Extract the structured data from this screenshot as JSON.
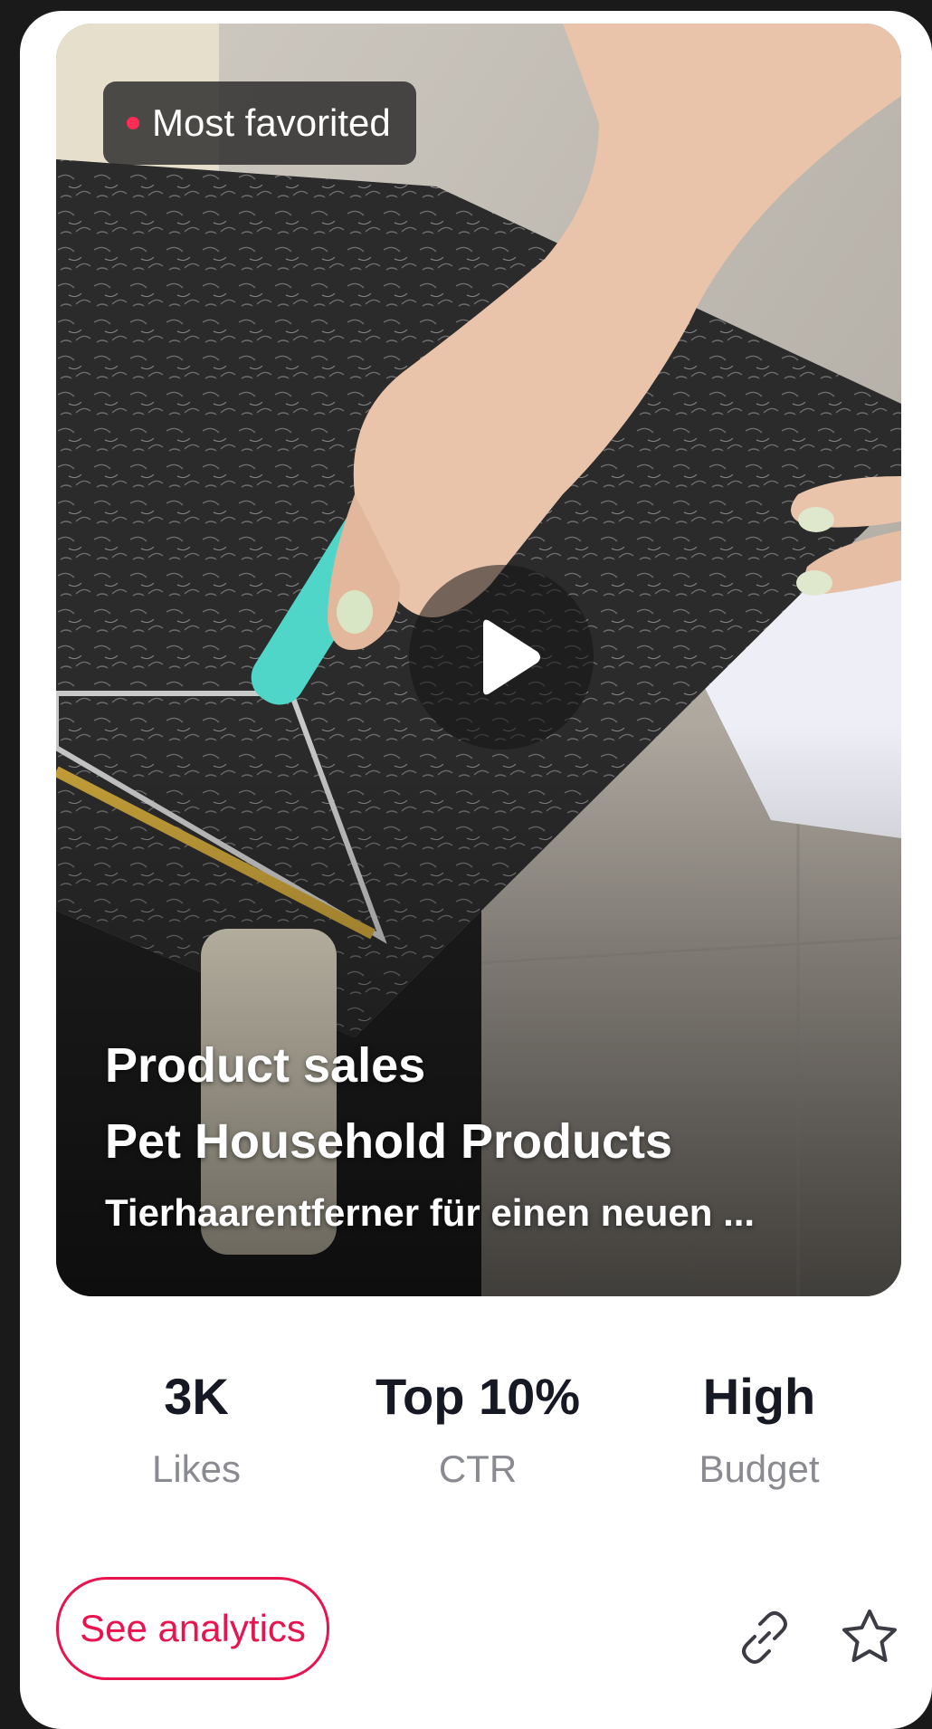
{
  "badge": {
    "label": "Most favorited",
    "dot_color": "#ff2c55"
  },
  "media": {
    "type": "video",
    "play_icon": "play-icon"
  },
  "caption": {
    "line1": "Product sales",
    "line2": "Pet Household Products",
    "line3": "Tierhaarentferner für einen neuen ..."
  },
  "stats": [
    {
      "value": "3K",
      "label": "Likes"
    },
    {
      "value": "Top 10%",
      "label": "CTR"
    },
    {
      "value": "High",
      "label": "Budget"
    }
  ],
  "actions": {
    "analytics_label": "See analytics",
    "link_icon": "link-icon",
    "favorite_icon": "star-icon",
    "accent_color": "#e8144f"
  }
}
